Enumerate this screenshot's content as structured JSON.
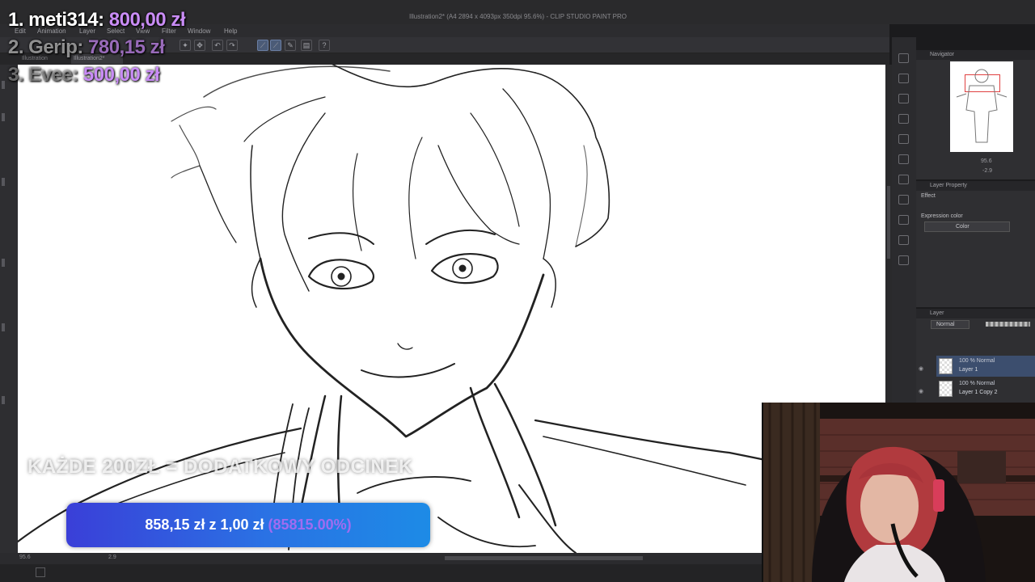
{
  "window": {
    "title": "Illustration2* (A4 2894 x 4093px 350dpi 95.6%) - CLIP STUDIO PAINT PRO"
  },
  "menu": [
    "Edit",
    "Animation",
    "Layer",
    "Select",
    "View",
    "Filter",
    "Window",
    "Help"
  ],
  "tabs": [
    "Illustration",
    "Illustration2*"
  ],
  "status": {
    "zoom": "95.6",
    "angle": "2.9"
  },
  "navigator": {
    "title": "Navigator",
    "zoom": "95.6",
    "angle": "-2.9"
  },
  "layer_property": {
    "title": "Layer Property",
    "effect_label": "Effect",
    "expression_label": "Expression color",
    "expression_value": "Color"
  },
  "layers": {
    "title": "Layer",
    "blend_mode": "Normal",
    "items": [
      {
        "mode": "100 % Normal",
        "name": "Layer 1"
      },
      {
        "mode": "100 % Normal",
        "name": "Layer 1 Copy 2"
      }
    ]
  },
  "overlay": {
    "ranks": [
      {
        "name": "1. meti314:",
        "amount": "800,00 zł"
      },
      {
        "name": "2. Gerip:",
        "amount": "780,15 zł"
      },
      {
        "name": "3. Evee:",
        "amount": "500,00 zł"
      }
    ],
    "promo": "KAŻDE 200ZŁ = DODATKOWY ODCINEK",
    "goal": {
      "progress_text": "858,15 zł z 1,00 zł",
      "percent_text": "(85815.00%)"
    }
  },
  "colors": {
    "accent_purple": "#c98cf6",
    "goal_start": "#3a3fd8",
    "goal_end": "#1d8be6",
    "panel_bg": "#2f2f32"
  }
}
